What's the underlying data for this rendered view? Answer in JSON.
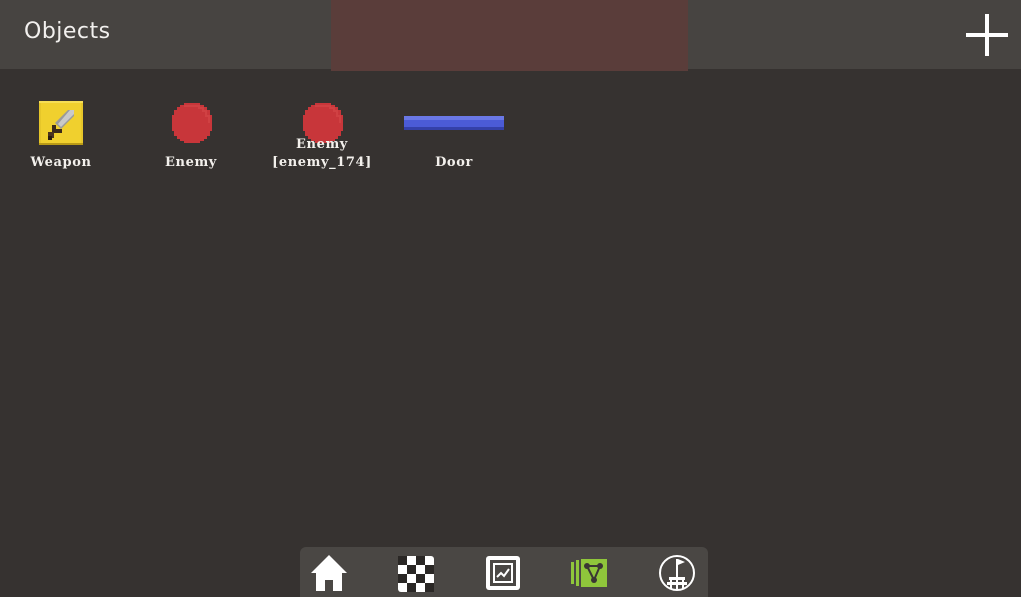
{
  "header": {
    "title": "Objects",
    "add_icon": "plus-icon"
  },
  "objects": [
    {
      "label_lines": [
        "Weapon"
      ],
      "icon": "sword-tile-icon",
      "color": "#e6c62a"
    },
    {
      "label_lines": [
        "Enemy"
      ],
      "icon": "red-circle-icon",
      "color": "#c8363a"
    },
    {
      "label_lines": [
        "Enemy",
        "[enemy_174]"
      ],
      "icon": "red-circle-icon",
      "color": "#c8363a"
    },
    {
      "label_lines": [
        "Door"
      ],
      "icon": "blue-bar-icon",
      "color": "#4b5bd6"
    }
  ],
  "toolbar": {
    "items": [
      {
        "icon": "home-icon",
        "active": false
      },
      {
        "icon": "checkerboard-icon",
        "active": false
      },
      {
        "icon": "frame-icon",
        "active": false
      },
      {
        "icon": "object-map-icon",
        "active": true,
        "color": "#8fc63b"
      },
      {
        "icon": "globe-flag-icon",
        "active": false
      }
    ]
  },
  "colors": {
    "background": "#363230",
    "header": "#474441",
    "header_highlight": "#5a3d3a",
    "toolbar": "#4a4744",
    "text": "#f3f0ec",
    "accent": "#8fc63b"
  }
}
